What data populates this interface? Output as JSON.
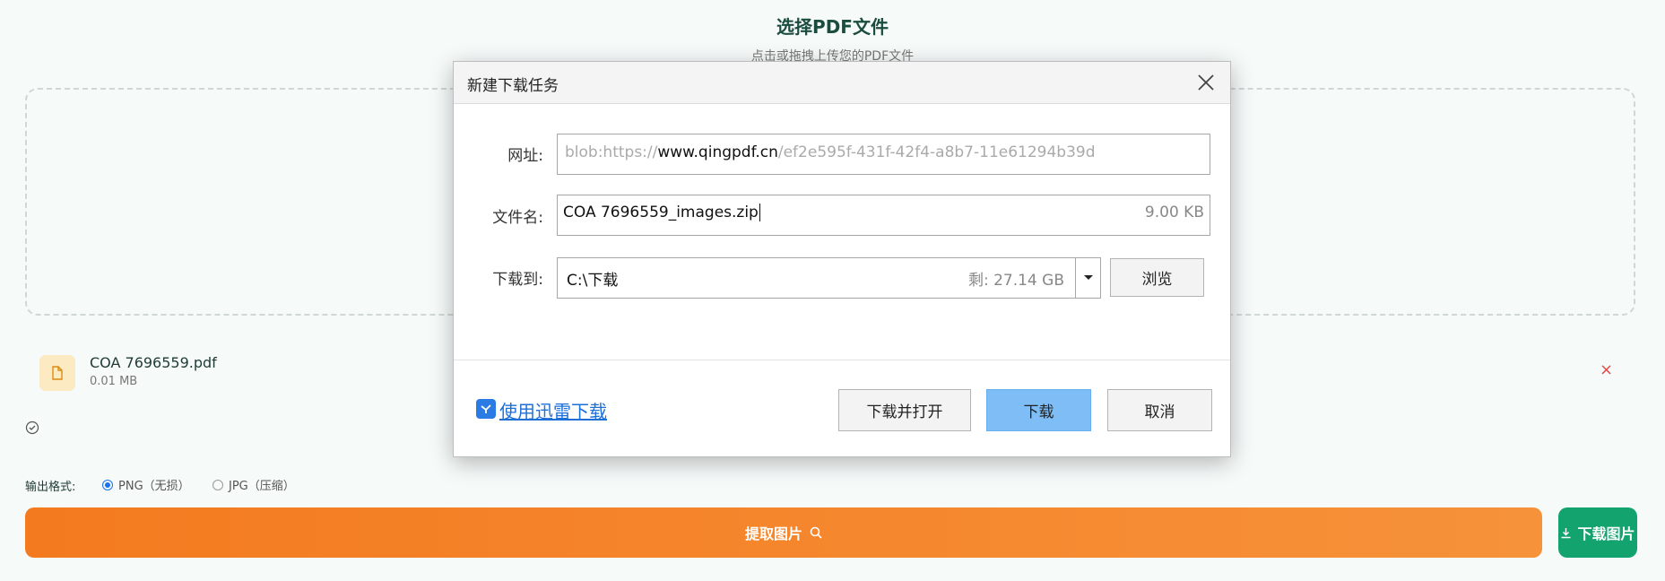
{
  "page": {
    "title": "选择PDF文件",
    "subtitle": "点击或拖拽上传您的PDF文件"
  },
  "file": {
    "name": "COA 7696559.pdf",
    "size": "0.01 MB",
    "remove": "×"
  },
  "format": {
    "label": "输出格式:",
    "options": [
      {
        "label": "PNG（无损）",
        "selected": true
      },
      {
        "label": "JPG（压缩）",
        "selected": false
      }
    ]
  },
  "actions": {
    "extract_label": "提取图片",
    "download_label": "下载图片"
  },
  "dialog": {
    "title": "新建下载任务",
    "url_label": "网址:",
    "url_prefix": "blob:https://",
    "url_host": "www.qingpdf.cn",
    "url_suffix": "/ef2e595f-431f-42f4-a8b7-11e61294b39d",
    "filename_label": "文件名:",
    "filename": "COA 7696559_images.zip",
    "filesize": "9.00 KB",
    "saveto_label": "下载到:",
    "path": "C:\\下载",
    "free_space": "剩: 27.14 GB",
    "browse_label": "浏览",
    "thunder_label": "使用迅雷下载",
    "download_open_label": "下载并打开",
    "download_label": "下载",
    "cancel_label": "取消"
  },
  "colors": {
    "accent_orange": "#f47a1f",
    "accent_green": "#13a36f",
    "dialog_primary": "#7ebdf6",
    "link_blue": "#1e6fd8"
  }
}
